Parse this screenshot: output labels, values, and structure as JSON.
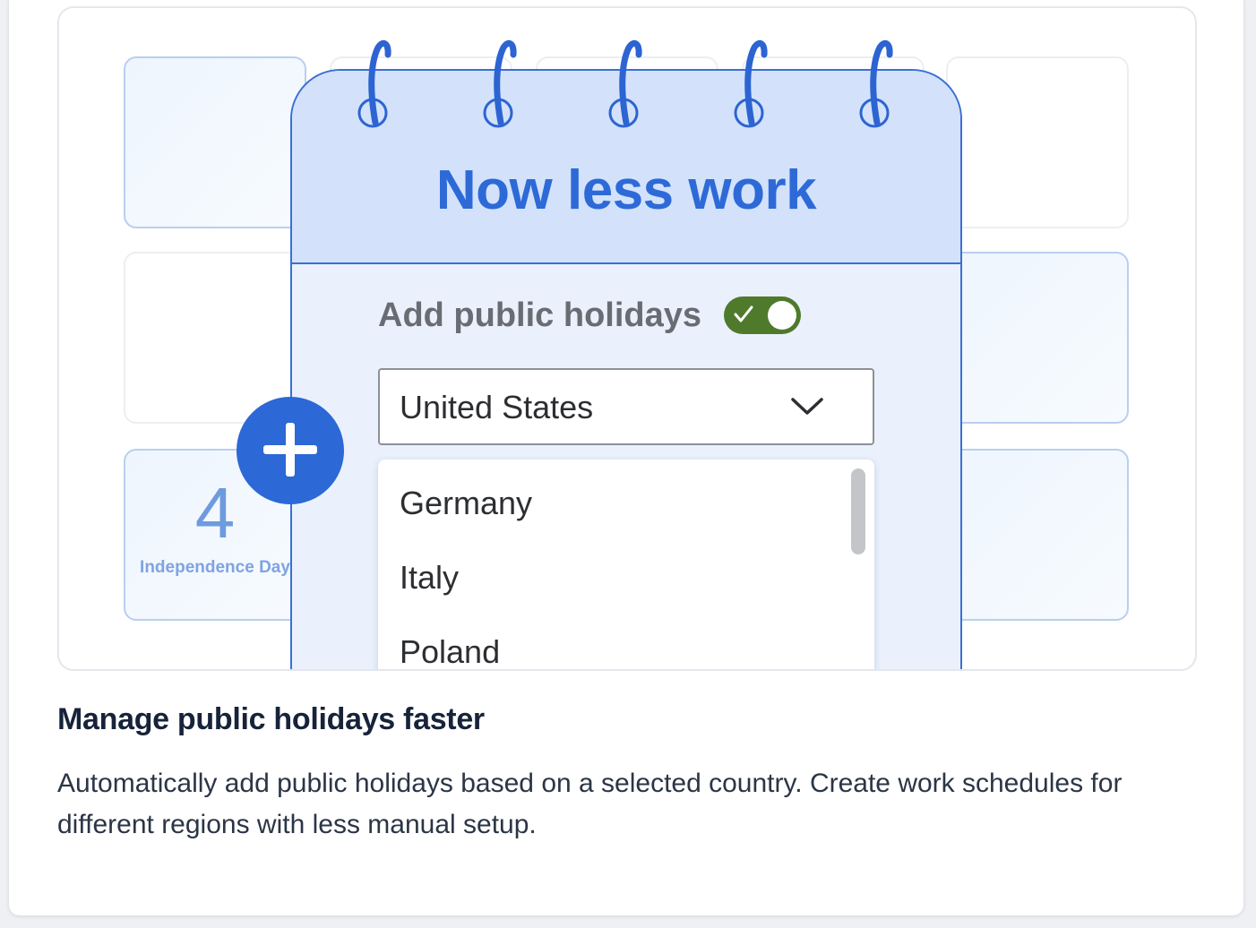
{
  "calendar": {
    "title": "Now less work",
    "add_label": "Add public holidays",
    "toggle_on": true,
    "selected_country": "United States",
    "options": [
      "Germany",
      "Italy",
      "Poland"
    ]
  },
  "day_cell": {
    "number": "4",
    "name": "Independence Day"
  },
  "feature": {
    "heading": "Manage public holidays faster",
    "description": "Automatically add public holidays based on a selected country. Create work schedules for different regions with less manual setup."
  },
  "colors": {
    "accent_blue": "#2d6ad8",
    "toggle_green": "#4f7a2c"
  },
  "icons": {
    "toggle_check": "checkmark-icon",
    "select_chevron": "chevron-down-icon",
    "add": "plus-icon"
  }
}
